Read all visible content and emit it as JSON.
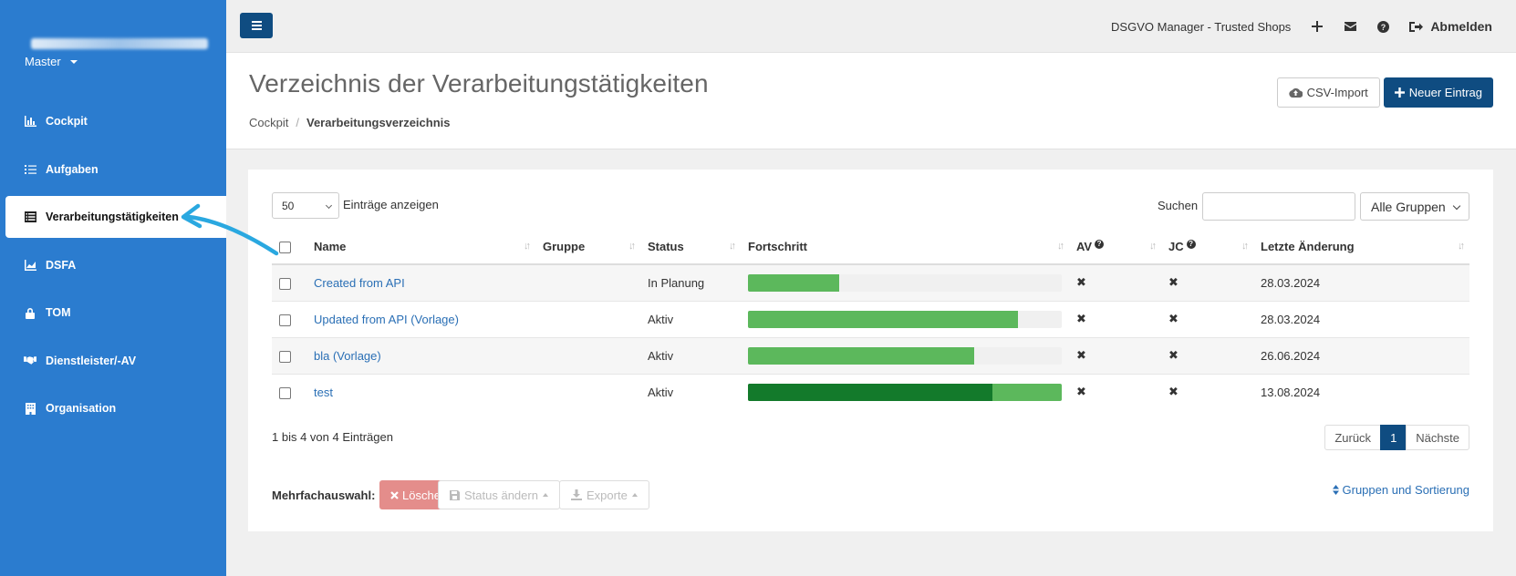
{
  "sidebar": {
    "tenant": "Master",
    "items": [
      {
        "label": "Cockpit",
        "icon": "chart-icon",
        "active": false
      },
      {
        "label": "Aufgaben",
        "icon": "tasks-icon",
        "active": false
      },
      {
        "label": "Verarbeitungstätigkeiten",
        "icon": "list-icon",
        "active": true
      },
      {
        "label": "DSFA",
        "icon": "area-chart-icon",
        "active": false
      },
      {
        "label": "TOM",
        "icon": "lock-icon",
        "active": false
      },
      {
        "label": "Dienstleister/-AV",
        "icon": "handshake-icon",
        "active": false
      },
      {
        "label": "Organisation",
        "icon": "building-icon",
        "active": false
      }
    ]
  },
  "topbar": {
    "title": "DSGVO Manager - Trusted Shops",
    "logout_label": "Abmelden"
  },
  "header": {
    "title": "Verzeichnis der Verarbeitungstätigkeiten",
    "breadcrumb": [
      "Cockpit",
      "Verarbeitungsverzeichnis"
    ],
    "csv_label": "CSV-Import",
    "new_label": "Neuer Eintrag"
  },
  "table_controls": {
    "page_length": "50",
    "page_length_label": "Einträge anzeigen",
    "search_label": "Suchen",
    "search_value": "",
    "group_filter": "Alle Gruppen"
  },
  "table": {
    "columns": [
      "Name",
      "Gruppe",
      "Status",
      "Fortschritt",
      "AV",
      "JC",
      "Letzte Änderung"
    ],
    "rows": [
      {
        "name": "Created from API",
        "gruppe": "",
        "status": "In Planung",
        "progress": 0.29,
        "progress_dark": 0,
        "av": "✖",
        "jc": "✖",
        "date": "28.03.2024"
      },
      {
        "name": "Updated from API (Vorlage)",
        "gruppe": "",
        "status": "Aktiv",
        "progress": 0.86,
        "progress_dark": 0,
        "av": "✖",
        "jc": "✖",
        "date": "28.03.2024"
      },
      {
        "name": "bla (Vorlage)",
        "gruppe": "",
        "status": "Aktiv",
        "progress": 0.72,
        "progress_dark": 0,
        "av": "✖",
        "jc": "✖",
        "date": "26.06.2024"
      },
      {
        "name": "test",
        "gruppe": "",
        "status": "Aktiv",
        "progress": 1.0,
        "progress_dark": 0.78,
        "av": "✖",
        "jc": "✖",
        "date": "13.08.2024"
      }
    ]
  },
  "footer": {
    "info": "1 bis 4 von 4 Einträgen",
    "prev": "Zurück",
    "page": "1",
    "next": "Nächste",
    "multi_label": "Mehrfachauswahl:",
    "delete_label": "Löschen",
    "status_label": "Status ändern",
    "export_label": "Exporte",
    "group_sort_label": "Gruppen und Sortierung"
  },
  "colors": {
    "sidebar": "#2b7ccf",
    "primary": "#0f4c81",
    "progress": "#5cb85c",
    "progress_dark": "#137a2b",
    "danger_light": "#e48d8b",
    "annotation_arrow": "#2aa8e0"
  }
}
